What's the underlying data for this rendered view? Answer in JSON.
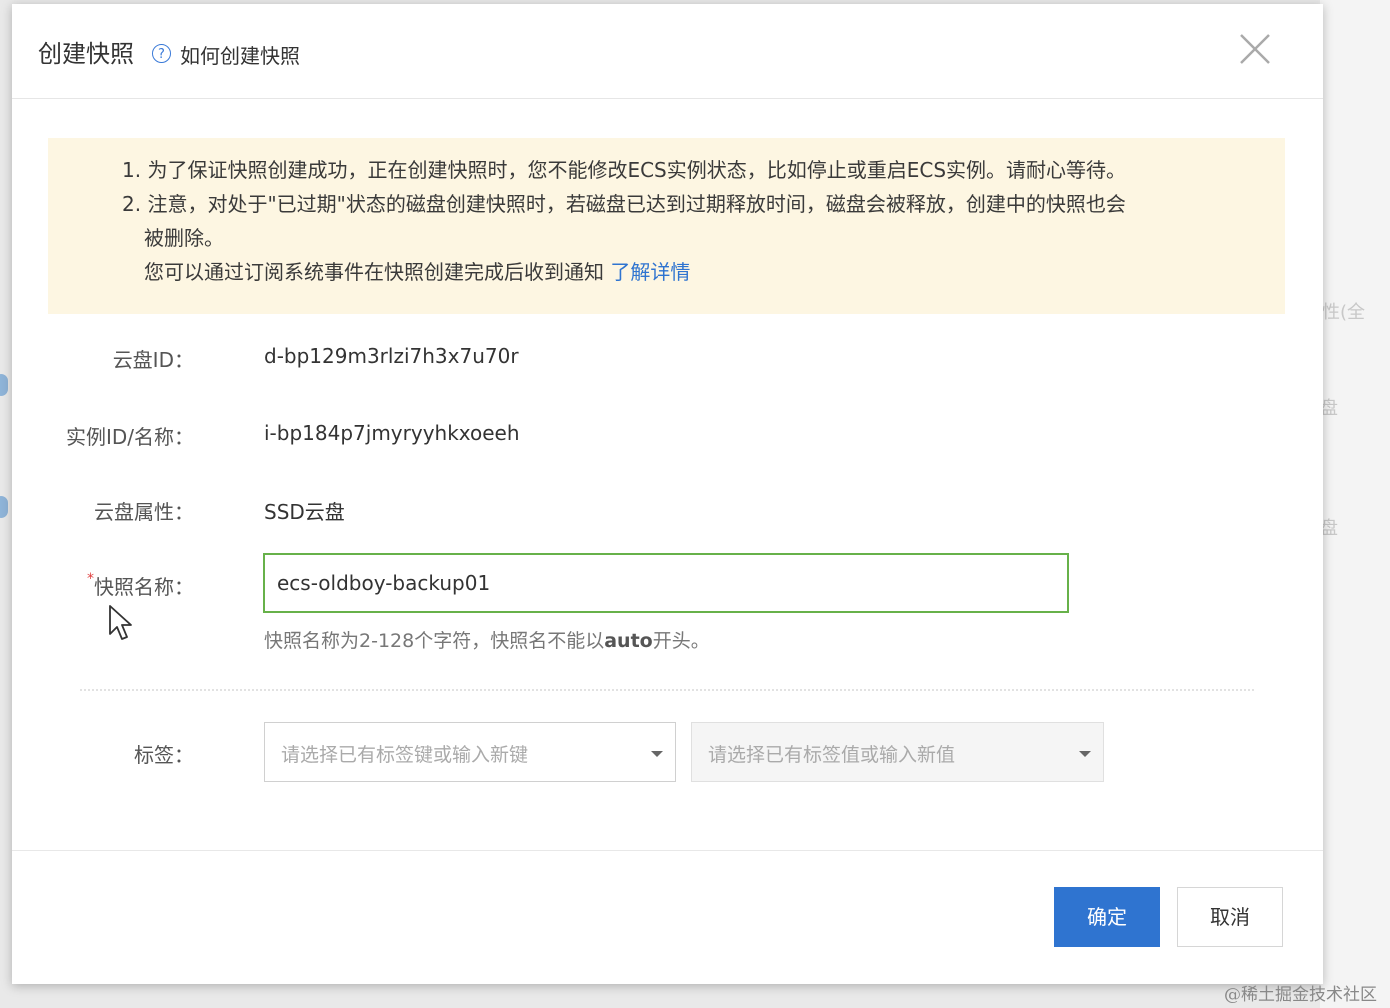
{
  "dialog": {
    "title": "创建快照",
    "help_link": "如何创建快照"
  },
  "notice": {
    "line1": "1. 为了保证快照创建成功，正在创建快照时，您不能修改ECS实例状态，比如停止或重启ECS实例。请耐心等待。",
    "line2a": "2. 注意，对处于\"已过期\"状态的磁盘创建快照时，若磁盘已达到过期释放时间，磁盘会被释放，创建中的快照也会",
    "line2b": "被删除。",
    "line3": "您可以通过订阅系统事件在快照创建完成后收到通知",
    "learn_more": "了解详情"
  },
  "form": {
    "disk_id_label": "云盘ID：",
    "disk_id_value": "d-bp129m3rlzi7h3x7u70r",
    "instance_label": "实例ID/名称：",
    "instance_value": "i-bp184p7jmyryyhkxoeeh",
    "disk_attr_label": "云盘属性：",
    "disk_attr_value": "SSD云盘",
    "snapshot_name_required": "*",
    "snapshot_name_label": "快照名称：",
    "snapshot_name_value": "ecs-oldboy-backup01",
    "hint_prefix": "快照名称为2-128个字符，快照名不能以",
    "hint_bold": "auto",
    "hint_suffix": "开头。",
    "tag_label": "标签：",
    "tag_key_placeholder": "请选择已有标签键或输入新键",
    "tag_value_placeholder": "请选择已有标签值或输入新值"
  },
  "buttons": {
    "confirm": "确定",
    "cancel": "取消"
  },
  "background": {
    "text1": "性(全",
    "text2": "盘",
    "text3": "盘"
  },
  "watermark": "@稀土掘金技术社区",
  "colors": {
    "accent": "#2f74d0",
    "input_focus_border": "#67b14a",
    "notice_bg": "#fdf6e2"
  }
}
